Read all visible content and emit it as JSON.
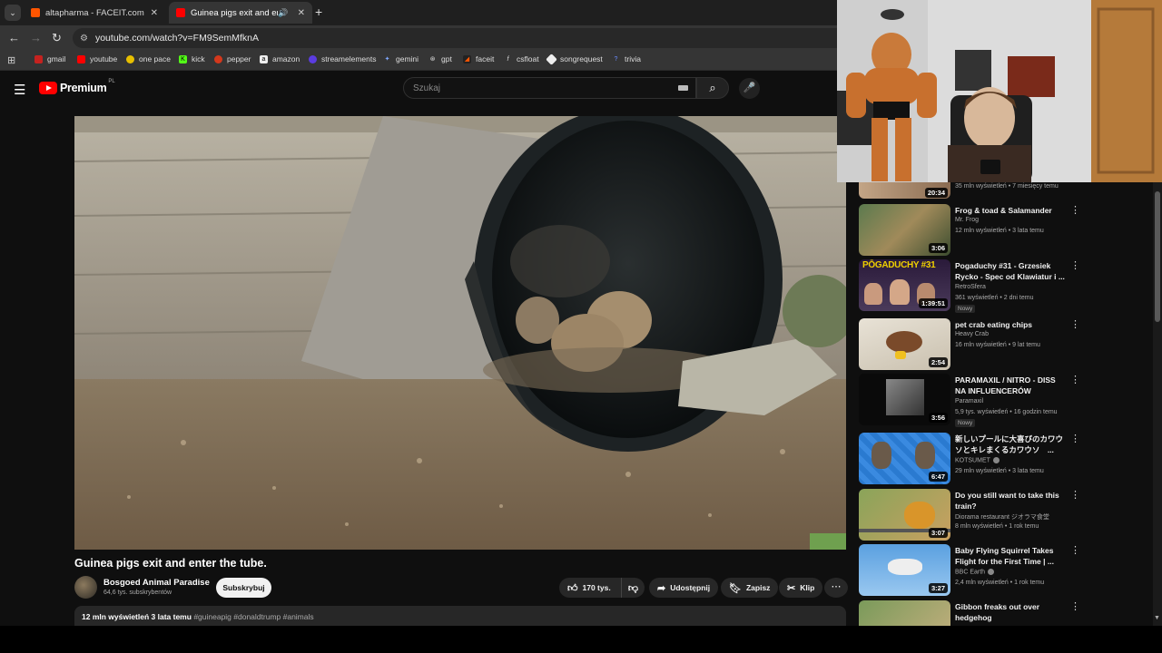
{
  "browser": {
    "tabs": [
      {
        "title": "altapharma - FACEIT.com"
      },
      {
        "title": "Guinea pigs exit and enter t"
      }
    ],
    "url": "youtube.com/watch?v=FM9SemMfknA",
    "bookmarks": [
      "gmail",
      "youtube",
      "one pace",
      "kick",
      "pepper",
      "amazon",
      "streamelements",
      "gemini",
      "gpt",
      "faceit",
      "csfloat",
      "songrequest",
      "trivia"
    ]
  },
  "header": {
    "logo": "Premium",
    "country": "PL",
    "search_placeholder": "Szukaj"
  },
  "video": {
    "title": "Guinea pigs exit and enter the tube.",
    "channel": "Bosgoed Animal Paradise",
    "subscribers": "64,6 tys. subskrybentów",
    "subscribe_label": "Subskrybuj",
    "likes": "170 tys.",
    "share_label": "Udostępnij",
    "save_label": "Zapisz",
    "clip_label": "Klip",
    "views_date": "12 mln wyświetleń  3 lata temu",
    "tags": "#guineapig #donaldtrump #animals"
  },
  "sidebar": [
    {
      "title": "",
      "channel": "",
      "meta": "35 mln wyświetleń • 7 miesięcy temu",
      "duration": "20:34"
    },
    {
      "title": "Frog & toad & Salamander",
      "channel": "Mr. Frog",
      "meta": "12 mln wyświetleń • 3 lata temu",
      "duration": "3:06"
    },
    {
      "title": "Pogaduchy #31 - Grzesiek Rycko - Spec od Klawiatur i ...",
      "channel": "RetroSfera",
      "meta": "361 wyświetleń • 2 dni temu",
      "badge": "Nowy",
      "duration": "1:39:51",
      "thumb_text": "PŌGADUCHY #31"
    },
    {
      "title": "pet crab eating chips",
      "channel": "Heavy Crab",
      "meta": "16 mln wyświetleń • 9 lat temu",
      "duration": "2:54"
    },
    {
      "title": "PARAMAXIL / NITRO - DISS NA INFLUENCERÓW (REFREN ...",
      "channel": "Paramaxil",
      "meta": "5,9 tys. wyświetleń • 16 godzin temu",
      "badge": "Nowy",
      "duration": "3:56"
    },
    {
      "title": "新しいプールに大喜びのカワウソとキレまくるカワウソ　...",
      "channel": "KOTSUMET",
      "meta": "29 mln wyświetleń • 3 lata temu",
      "duration": "6:47"
    },
    {
      "title": "Do you still want to take this train?",
      "channel": "Diorama restaurant ジオラマ食堂",
      "meta": "8 mln wyświetleń • 1 rok temu",
      "duration": "3:07"
    },
    {
      "title": "Baby Flying Squirrel Takes Flight for the First Time | ...",
      "channel": "BBC Earth",
      "meta": "2,4 mln wyświetleń • 1 rok temu",
      "duration": "3:27"
    },
    {
      "title": "Gibbon freaks out over hedgehog",
      "channel": "",
      "meta": "",
      "duration": ""
    }
  ],
  "colors": {
    "accent": "#ff0000",
    "background": "#0f0f0f",
    "chip": "#272727"
  }
}
